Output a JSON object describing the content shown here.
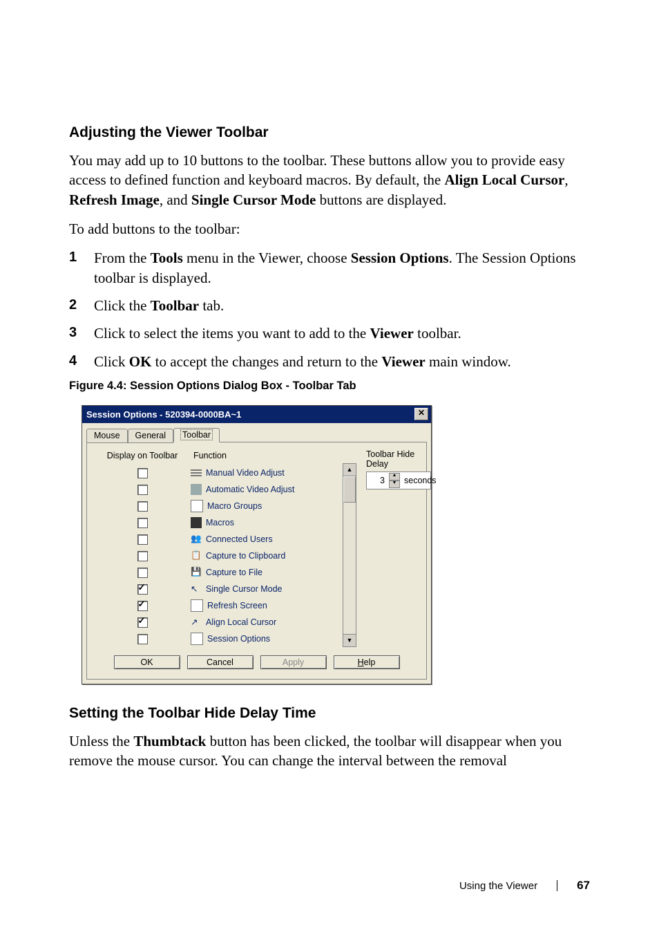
{
  "section1": {
    "heading": "Adjusting the Viewer Toolbar",
    "para1_a": "You may add up to 10 buttons to the toolbar. These buttons allow you to provide easy access to defined function and keyboard macros. By default, the ",
    "b1": "Align Local Cursor",
    "c1": ", ",
    "b2": "Refresh Image",
    "c2": ", and ",
    "b3": "Single Cursor Mode",
    "para1_b": " buttons are displayed.",
    "para2": "To add buttons to the toolbar:",
    "steps": [
      {
        "n": "1",
        "pre": "From the ",
        "t1": "Tools",
        "mid": " menu in the Viewer, choose ",
        "t2": "Session Options",
        "post": ". The Session Options toolbar is displayed."
      },
      {
        "n": "2",
        "pre": "Click the ",
        "t1": "Toolbar",
        "post": " tab."
      },
      {
        "n": "3",
        "pre": "Click to select the items you want to add to the ",
        "t1": "Viewer",
        "post": " toolbar."
      },
      {
        "n": "4",
        "pre": "Click ",
        "t1": "OK",
        "mid": " to accept the changes and return to the ",
        "t2": "Viewer",
        "post": " main window."
      }
    ],
    "figcap": "Figure 4.4: Session Options Dialog Box - Toolbar Tab"
  },
  "dialog": {
    "title": "Session Options - 520394-0000BA~1",
    "tabs": [
      "Mouse",
      "General",
      "Toolbar"
    ],
    "activeTab": 2,
    "col1": "Display on Toolbar",
    "col2": "Function",
    "rows": [
      {
        "checked": false,
        "label": "Manual Video Adjust"
      },
      {
        "checked": false,
        "label": "Automatic Video Adjust"
      },
      {
        "checked": false,
        "label": "Macro Groups"
      },
      {
        "checked": false,
        "label": "Macros"
      },
      {
        "checked": false,
        "label": "Connected Users"
      },
      {
        "checked": false,
        "label": "Capture to Clipboard"
      },
      {
        "checked": false,
        "label": "Capture to File"
      },
      {
        "checked": true,
        "label": "Single Cursor Mode"
      },
      {
        "checked": true,
        "label": "Refresh Screen"
      },
      {
        "checked": true,
        "label": "Align Local Cursor"
      },
      {
        "checked": false,
        "label": "Session Options"
      }
    ],
    "right": {
      "label": "Toolbar Hide Delay",
      "value": "3",
      "suffix": "seconds"
    },
    "buttons": {
      "ok": "OK",
      "cancel": "Cancel",
      "apply": "Apply",
      "help_pre": "",
      "help_ul": "H",
      "help_post": "elp"
    }
  },
  "section2": {
    "heading": "Setting the Toolbar Hide Delay Time",
    "para_a": "Unless the ",
    "b1": "Thumbtack",
    "para_b": " button has been clicked, the toolbar will disappear when you remove the mouse cursor. You can change the interval between the removal"
  },
  "footer": {
    "text": "Using the Viewer",
    "page": "67"
  }
}
